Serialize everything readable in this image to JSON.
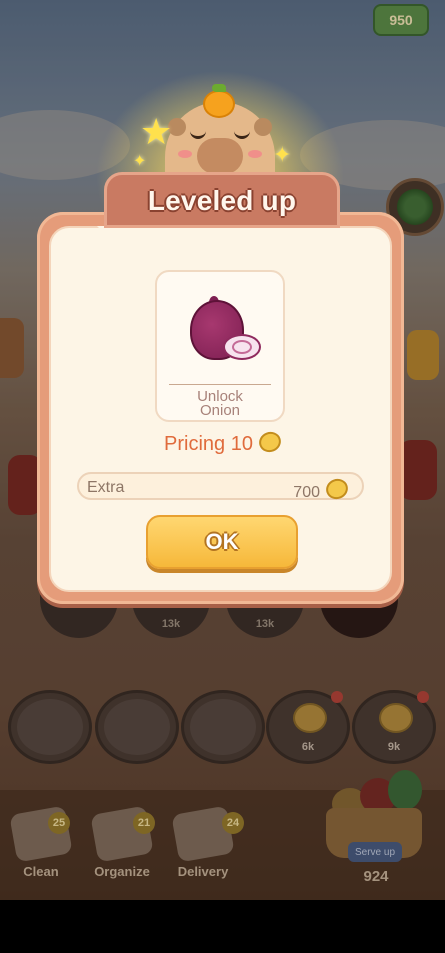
{
  "top": {
    "coins": "950"
  },
  "dialog": {
    "title": "Leveled up",
    "unlock_text": "Unlock\nOnion",
    "unlock_item_icon": "onion-icon",
    "pricing": "Pricing 10",
    "extra_label": "Extra",
    "extra_value": "700",
    "ok_label": "OK"
  },
  "plates_mid": [
    "13k",
    "13k"
  ],
  "plates_bottom": [
    {
      "label": ""
    },
    {
      "label": ""
    },
    {
      "label": ""
    },
    {
      "label": "6k"
    },
    {
      "label": "9k"
    }
  ],
  "toolbar": {
    "items": [
      {
        "label": "Clean",
        "badge": "25"
      },
      {
        "label": "Organize",
        "badge": "21"
      },
      {
        "label": "Delivery",
        "badge": "24"
      }
    ],
    "serve_label": "Serve up",
    "serve_count": "924"
  },
  "colors": {
    "accent": "#e06b3c",
    "button": "#f6b83a",
    "dialog_frame": "#e59c7a"
  }
}
